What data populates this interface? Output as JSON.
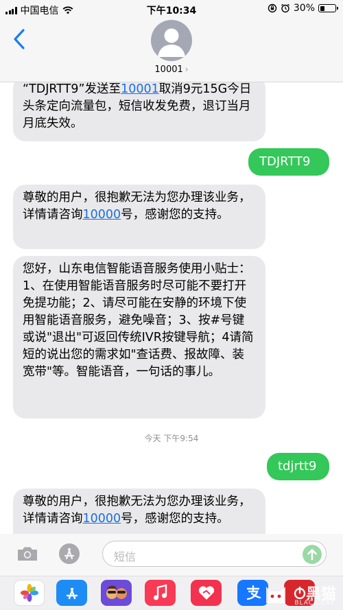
{
  "status_bar": {
    "carrier": "中国电信",
    "time": "下午10:34",
    "battery_percent": "30%",
    "battery_level": 0.3
  },
  "header": {
    "contact": "10001"
  },
  "messages": {
    "m1": {
      "pre": "“TDJRTT9”发送至",
      "link": "10001",
      "post": "取消9元15G今日头条定向流量包，短信收发免费，退订当月月底失效。"
    },
    "m2": {
      "text": "TDJRTT9"
    },
    "m3": {
      "pre": "尊敬的用户，很抱歉无法为您办理该业务，详情请咨询",
      "link": "10000",
      "post": "号，感谢您的支持。"
    },
    "m4": {
      "text": "您好，山东电信智能语音服务使用小贴士：1、在使用智能语音服务时尽可能不要打开免提功能；2、请尽可能在安静的环境下使用智能语音服务，避免噪音；3、按#号键或说\"退出\"可返回传统IVR按键导航；4请简短的说出您的需求如\"查话费、报故障、装宽带\"等。智能语音，一句话的事儿。"
    },
    "timestamp": "今天 下午9:54",
    "m5": {
      "text": "tdjrtt9"
    },
    "m6": {
      "pre": "尊敬的用户，很抱歉无法为您办理该业务，详情请咨询",
      "link": "10000",
      "post": "号，感谢您的支持。"
    }
  },
  "input": {
    "placeholder": "短信"
  },
  "watermark": {
    "text": "黑猫",
    "sub": "BLACK CAT"
  },
  "colors": {
    "incoming": "#e9e9eb",
    "outgoing": "#34c759",
    "link": "#1a6fe0"
  }
}
